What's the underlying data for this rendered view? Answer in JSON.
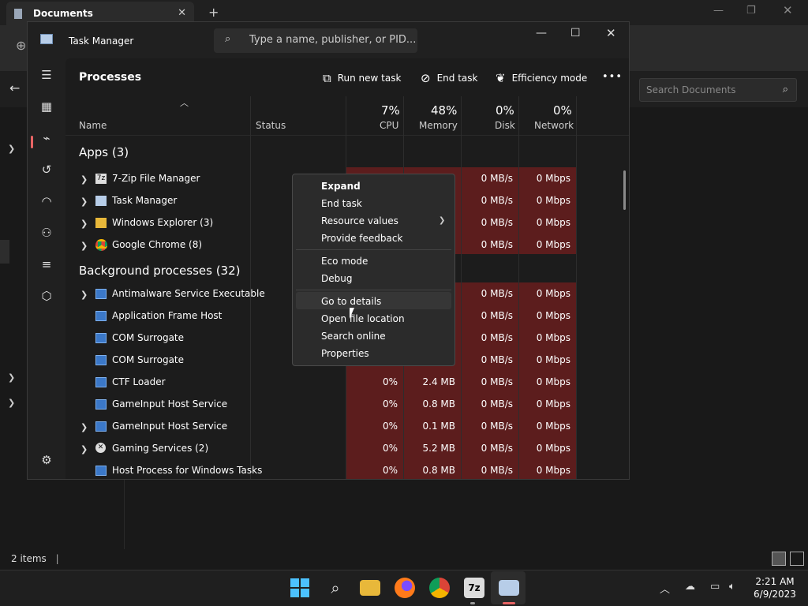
{
  "explorer": {
    "tab_title": "Documents",
    "search_placeholder": "Search Documents",
    "status": "2 items"
  },
  "taskmanager": {
    "title": "Task Manager",
    "search_placeholder": "Type a name, publisher, or PID...",
    "page_title": "Processes",
    "commands": {
      "run_new_task": "Run new task",
      "end_task": "End task",
      "efficiency_mode": "Efficiency mode",
      "more": "•••"
    },
    "columns": {
      "name": "Name",
      "status": "Status",
      "cpu_pct": "7%",
      "cpu": "CPU",
      "memory_pct": "48%",
      "memory": "Memory",
      "disk_pct": "0%",
      "disk": "Disk",
      "network_pct": "0%",
      "network": "Network"
    },
    "groups": {
      "apps": "Apps (3)",
      "background": "Background processes (32)"
    },
    "apps": [
      {
        "name": "7-Zip File Manager",
        "disk": "0 MB/s",
        "network": "0 Mbps"
      },
      {
        "name": "Task Manager",
        "disk": "0 MB/s",
        "network": "0 Mbps"
      },
      {
        "name": "Windows Explorer (3)",
        "disk": "0 MB/s",
        "network": "0 Mbps"
      },
      {
        "name": "Google Chrome (8)",
        "disk": "0 MB/s",
        "network": "0 Mbps"
      }
    ],
    "background": [
      {
        "name": "Antimalware Service Executable",
        "cpu": "",
        "memory": "",
        "disk": "0 MB/s",
        "network": "0 Mbps"
      },
      {
        "name": "Application Frame Host",
        "cpu": "",
        "memory": "",
        "disk": "0 MB/s",
        "network": "0 Mbps"
      },
      {
        "name": "COM Surrogate",
        "cpu": "",
        "memory": "",
        "disk": "0 MB/s",
        "network": "0 Mbps"
      },
      {
        "name": "COM Surrogate",
        "cpu": "",
        "memory": "",
        "disk": "0 MB/s",
        "network": "0 Mbps"
      },
      {
        "name": "CTF Loader",
        "cpu": "0%",
        "memory": "2.4 MB",
        "disk": "0 MB/s",
        "network": "0 Mbps"
      },
      {
        "name": "GameInput Host Service",
        "cpu": "0%",
        "memory": "0.8 MB",
        "disk": "0 MB/s",
        "network": "0 Mbps"
      },
      {
        "name": "GameInput Host Service",
        "cpu": "0%",
        "memory": "0.1 MB",
        "disk": "0 MB/s",
        "network": "0 Mbps"
      },
      {
        "name": "Gaming Services (2)",
        "cpu": "0%",
        "memory": "5.2 MB",
        "disk": "0 MB/s",
        "network": "0 Mbps"
      },
      {
        "name": "Host Process for Windows Tasks",
        "cpu": "0%",
        "memory": "0.8 MB",
        "disk": "0 MB/s",
        "network": "0 Mbps"
      }
    ]
  },
  "context_menu": {
    "expand": "Expand",
    "end_task": "End task",
    "resource_values": "Resource values",
    "provide_feedback": "Provide feedback",
    "eco_mode": "Eco mode",
    "debug": "Debug",
    "go_to_details": "Go to details",
    "open_file_location": "Open file location",
    "search_online": "Search online",
    "properties": "Properties"
  },
  "taskbar": {
    "time": "2:21 AM",
    "date": "6/9/2023",
    "seven_zip_label": "7z"
  },
  "colors": {
    "heat": "#5c1d1d",
    "accent": "#e86464"
  }
}
